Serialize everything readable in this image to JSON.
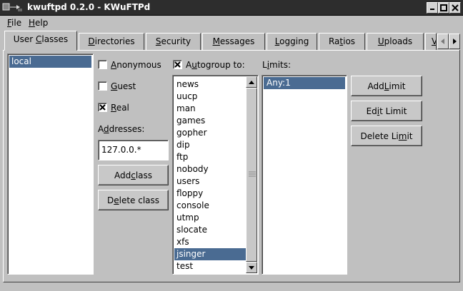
{
  "window": {
    "title": "kwuftpd 0.2.0 - KWuFTPd"
  },
  "menubar": {
    "items": [
      {
        "prefix": "",
        "mnemonic": "F",
        "rest": "ile"
      },
      {
        "prefix": "",
        "mnemonic": "H",
        "rest": "elp"
      }
    ]
  },
  "tabs": [
    {
      "prefix": "User ",
      "mnemonic": "C",
      "rest": "lasses",
      "active": true
    },
    {
      "prefix": "",
      "mnemonic": "D",
      "rest": "irectories",
      "active": false
    },
    {
      "prefix": "",
      "mnemonic": "S",
      "rest": "ecurity",
      "active": false
    },
    {
      "prefix": "",
      "mnemonic": "M",
      "rest": "essages",
      "active": false
    },
    {
      "prefix": "",
      "mnemonic": "L",
      "rest": "ogging",
      "active": false
    },
    {
      "prefix": "Ra",
      "mnemonic": "t",
      "rest": "ios",
      "active": false
    },
    {
      "prefix": "",
      "mnemonic": "U",
      "rest": "ploads",
      "active": false
    },
    {
      "prefix": "",
      "mnemonic": "V",
      "rest": "",
      "active": false
    }
  ],
  "classes_list": {
    "items": [
      "local"
    ],
    "selected_index": 0
  },
  "class_options": {
    "anonymous": {
      "prefix": "",
      "mnemonic": "A",
      "rest": "nonymous",
      "checked": false
    },
    "guest": {
      "prefix": "",
      "mnemonic": "G",
      "rest": "uest",
      "checked": false
    },
    "real": {
      "prefix": "",
      "mnemonic": "R",
      "rest": "eal",
      "checked": true
    },
    "addresses_label": {
      "prefix": "A",
      "mnemonic": "d",
      "rest": "dresses:"
    },
    "addresses_value": "127.0.0.*",
    "add_class": {
      "prefix": "Add ",
      "mnemonic": "c",
      "rest": "lass"
    },
    "delete_class": {
      "prefix": "D",
      "mnemonic": "e",
      "rest": "lete class"
    }
  },
  "autogroup": {
    "label": {
      "prefix": "A",
      "mnemonic": "u",
      "rest": "togroup to:"
    },
    "checked": true,
    "groups": [
      "news",
      "uucp",
      "man",
      "games",
      "gopher",
      "dip",
      "ftp",
      "nobody",
      "users",
      "floppy",
      "console",
      "utmp",
      "slocate",
      "xfs",
      "jsinger",
      "test"
    ],
    "selected_index": 14
  },
  "limits": {
    "label": {
      "prefix": "L",
      "mnemonic": "i",
      "rest": "mits:"
    },
    "items": [
      "Any:1"
    ],
    "selected_index": 0,
    "add_limit": {
      "prefix": "Add ",
      "mnemonic": "L",
      "rest": "imit"
    },
    "edit_limit": {
      "prefix": "Ed",
      "mnemonic": "i",
      "rest": "t Limit"
    },
    "delete_limit": {
      "prefix": "Delete Li",
      "mnemonic": "m",
      "rest": "it"
    }
  }
}
